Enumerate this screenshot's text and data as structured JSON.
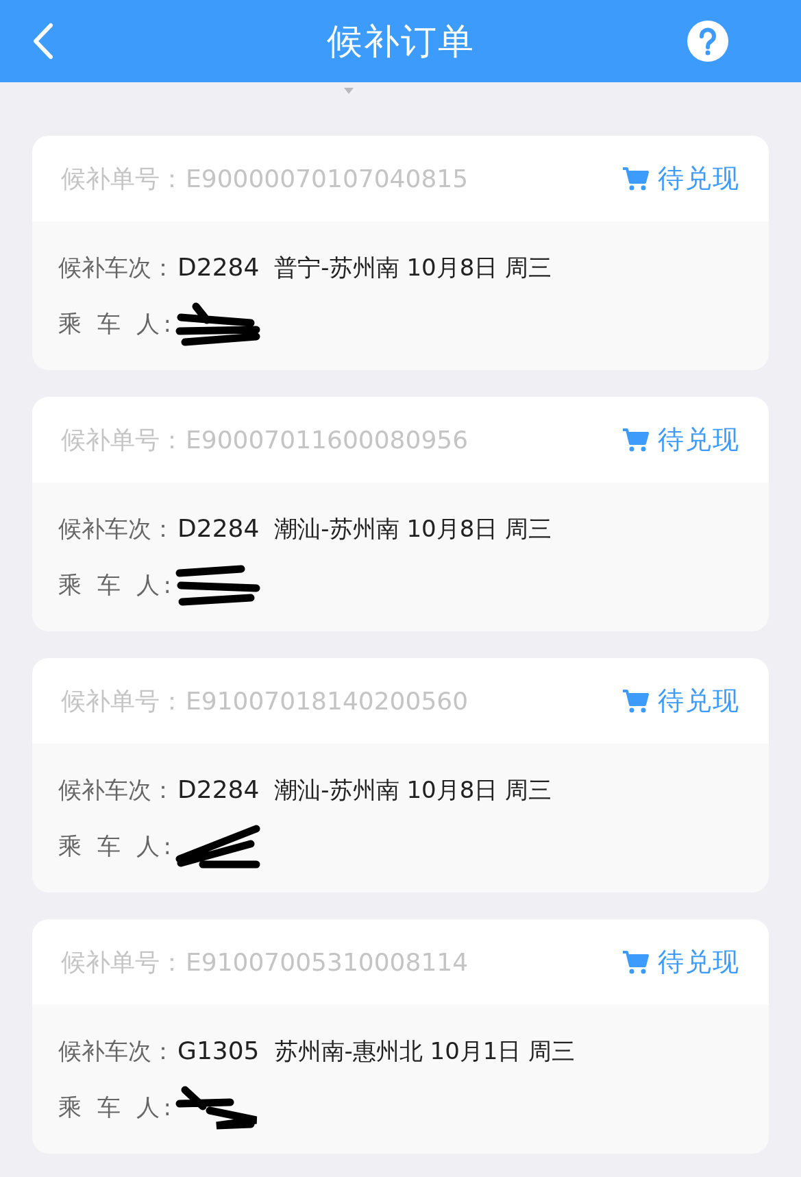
{
  "header": {
    "title": "候补订单"
  },
  "orders": [
    {
      "order_label": "候补单号：",
      "order_no": "E90000070107040815",
      "status": "待兑现",
      "train_label": "候补车次：",
      "train_no": "D2284",
      "route": "普宁-苏州南 10月8日 周三",
      "passenger_label": "乘 车 人:",
      "passenger_redacted": true
    },
    {
      "order_label": "候补单号：",
      "order_no": "E90007011600080956",
      "status": "待兑现",
      "train_label": "候补车次：",
      "train_no": "D2284",
      "route": "潮汕-苏州南 10月8日 周三",
      "passenger_label": "乘 车 人:",
      "passenger_redacted": true
    },
    {
      "order_label": "候补单号：",
      "order_no": "E91007018140200560",
      "status": "待兑现",
      "train_label": "候补车次：",
      "train_no": "D2284",
      "route": "潮汕-苏州南 10月8日 周三",
      "passenger_label": "乘 车 人:",
      "passenger_redacted": true
    },
    {
      "order_label": "候补单号：",
      "order_no": "E91007005310008114",
      "status": "待兑现",
      "train_label": "候补车次：",
      "train_no": "G1305",
      "route": "苏州南-惠州北 10月1日 周三",
      "passenger_label": "乘 车 人:",
      "passenger_redacted": true
    }
  ]
}
